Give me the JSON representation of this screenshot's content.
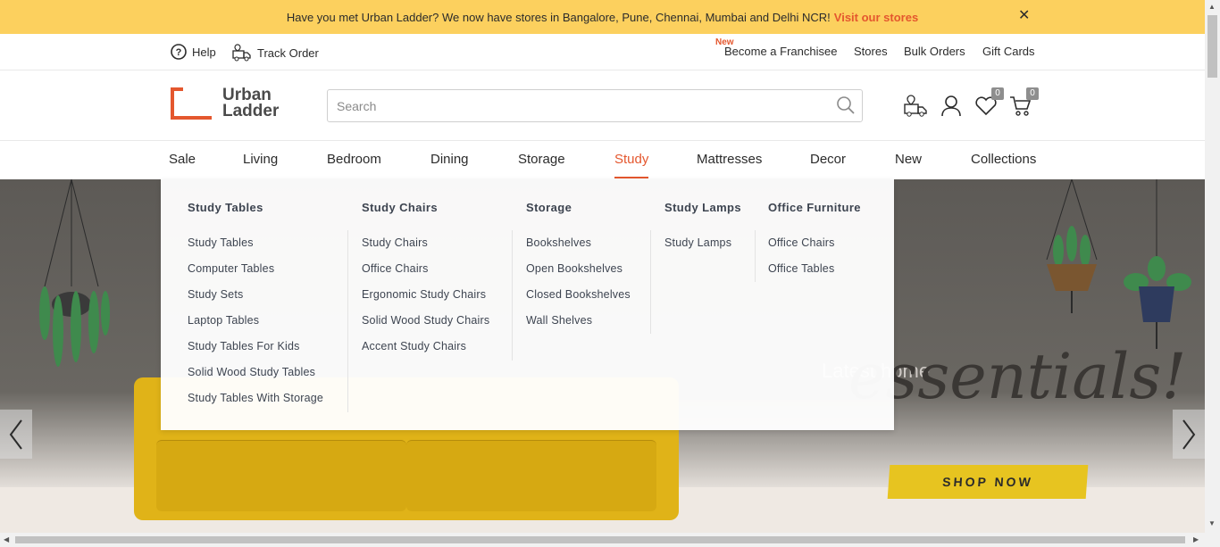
{
  "promo": {
    "text": "Have you met Urban Ladder? We now have stores in Bangalore, Pune, Chennai, Mumbai and Delhi NCR!",
    "link": "Visit our stores",
    "close": "✕"
  },
  "utility": {
    "help": "Help",
    "track_order": "Track Order",
    "new_badge": "New",
    "franchisee": "Become a Franchisee",
    "stores": "Stores",
    "bulk_orders": "Bulk Orders",
    "gift_cards": "Gift Cards"
  },
  "header": {
    "logo_line1": "Urban",
    "logo_line2": "Ladder",
    "search_placeholder": "Search",
    "wishlist_count": "0",
    "cart_count": "0"
  },
  "nav": {
    "items": [
      "Sale",
      "Living",
      "Bedroom",
      "Dining",
      "Storage",
      "Study",
      "Mattresses",
      "Decor",
      "New",
      "Collections"
    ],
    "active": "Study"
  },
  "mega_menu": {
    "columns": [
      {
        "title": "Study Tables",
        "links": [
          "Study Tables",
          "Computer Tables",
          "Study Sets",
          "Laptop Tables",
          "Study Tables For Kids",
          "Solid Wood Study Tables",
          "Study Tables With Storage"
        ]
      },
      {
        "title": "Study Chairs",
        "links": [
          "Study Chairs",
          "Office Chairs",
          "Ergonomic Study Chairs",
          "Solid Wood Study Chairs",
          "Accent Study Chairs"
        ]
      },
      {
        "title": "Storage",
        "links": [
          "Bookshelves",
          "Open Bookshelves",
          "Closed Bookshelves",
          "Wall Shelves"
        ]
      },
      {
        "title": "Study Lamps",
        "links": [
          "Study Lamps"
        ]
      },
      {
        "title": "Office Furniture",
        "links": [
          "Office Chairs",
          "Office Tables"
        ]
      }
    ]
  },
  "hero": {
    "subtitle": "Latest home",
    "headline": "essentials!",
    "cta": "SHOP NOW"
  },
  "colors": {
    "accent": "#e4572e",
    "promo_bg": "#fcd05e",
    "cta_bg": "#e7c420"
  }
}
